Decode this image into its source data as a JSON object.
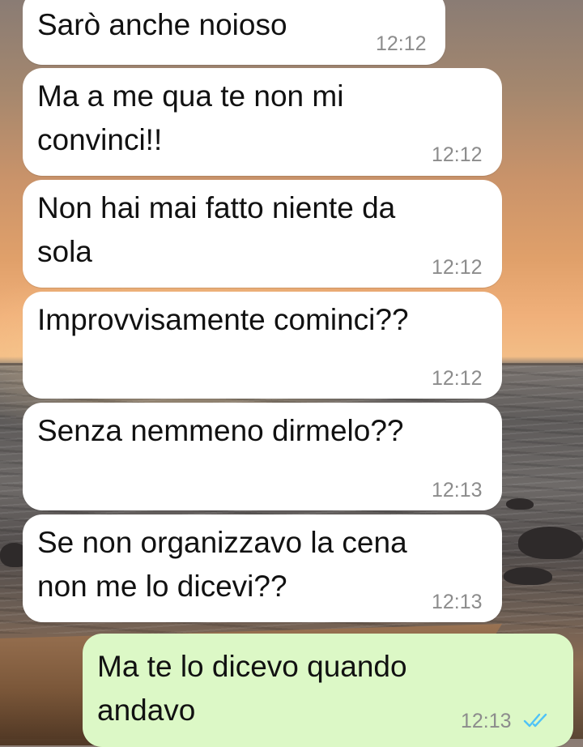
{
  "messages": [
    {
      "text": "Sarò anche noioso",
      "time": "12:12"
    },
    {
      "text": "Ma a me qua te non mi\nconvinci!!",
      "time": "12:12"
    },
    {
      "text": "Non hai mai fatto niente da\nsola",
      "time": "12:12"
    },
    {
      "text": "Improvvisamente cominci??",
      "time": "12:12"
    },
    {
      "text": "Senza nemmeno dirmelo??",
      "time": "12:13"
    },
    {
      "text": "Se non organizzavo la cena\nnon me lo dicevi??",
      "time": "12:13"
    },
    {
      "text": "Ma te lo dicevo quando\nandavo",
      "time": "12:13",
      "status_icon": "double-check-read-icon"
    }
  ],
  "colors": {
    "incoming_bubble": "#ffffff",
    "outgoing_bubble": "#dcf8c6",
    "timestamp": "#8c8c8c",
    "read_ticks": "#4fc3f7"
  }
}
